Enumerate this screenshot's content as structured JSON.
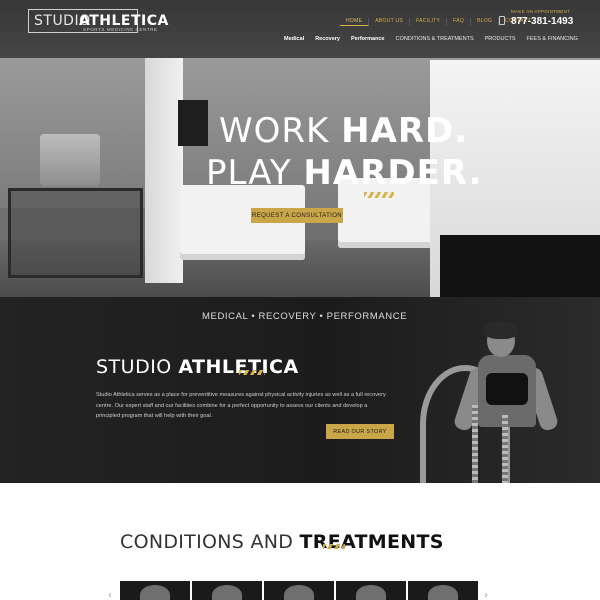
{
  "header": {
    "logo": {
      "studio": "STUDIO",
      "athletica": "ATHLETICA",
      "tagline": "SPORTS MEDICINE CENTRE"
    },
    "top_nav": [
      "HOME",
      "ABOUT US",
      "FACILITY",
      "FAQ",
      "BLOG",
      "CONTACT"
    ],
    "appointment_label": "MAKE AN APPOINTMENT",
    "phone": "877-381-1493",
    "main_nav": [
      "Medical",
      "Recovery",
      "Performance",
      "CONDITIONS & TREATMENTS",
      "PRODUCTS",
      "FEES & FINANCING"
    ]
  },
  "hero": {
    "line1_light": "WORK ",
    "line1_bold": "HARD.",
    "line2_light": "PLAY ",
    "line2_bold": "HARDER.",
    "cta": "REQUEST A CONSULTATION"
  },
  "about": {
    "tagline": "MEDICAL • RECOVERY • PERFORMANCE",
    "title_light": "STUDIO ",
    "title_bold": "ATHLETICA",
    "text": "Studio Athletica serves as a place for preventitive measures against physical activity injuries as well as a full recovery centre. Our expert staff and our facilities combine for a perfect opportunity to assess our clients and develop a principled program that will help with their goal.",
    "cta": "READ OUR STORY"
  },
  "conditions": {
    "title_light": "CONDITIONS AND ",
    "title_bold": "TREATMENTS",
    "prev_arrow": "‹",
    "next_arrow": "›"
  },
  "colors": {
    "accent": "#c9a748",
    "dark": "#1c1c1c"
  }
}
